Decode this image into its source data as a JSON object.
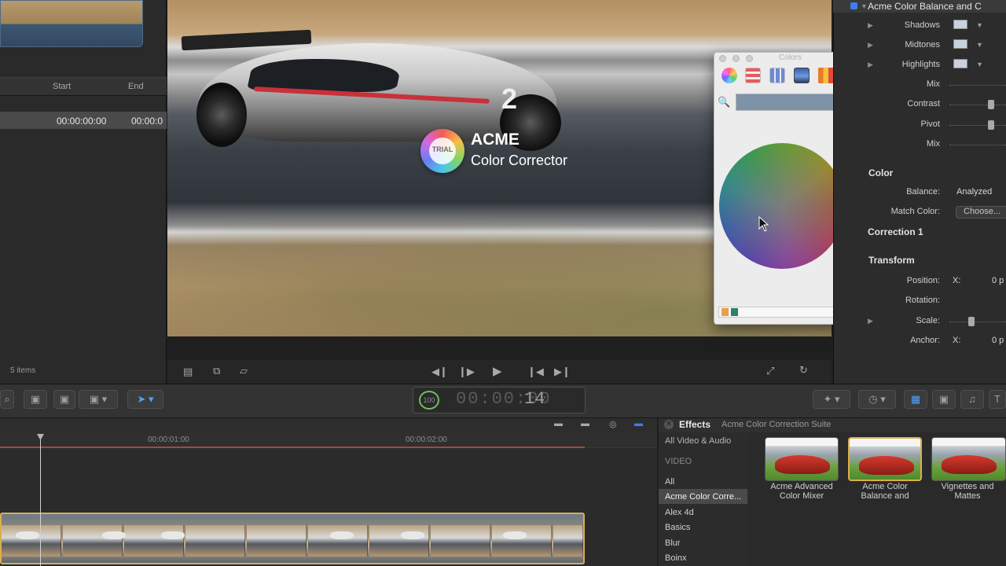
{
  "browser": {
    "col_start": "Start",
    "col_end": "End",
    "row_start": "00:00:00:00",
    "row_end": "00:00:0",
    "items_count": "5 items"
  },
  "viewer": {
    "car_number": "2",
    "trial_badge": "TRIAL",
    "brand_title": "ACME",
    "brand_subtitle": "Color Corrector"
  },
  "colors_window": {
    "title": "Colors",
    "search_icon": "search-icon",
    "selected_color": "#7f93a8"
  },
  "inspector": {
    "title": "Acme Color Balance and C",
    "rows": {
      "shadows": "Shadows",
      "midtones": "Midtones",
      "highlights": "Highlights",
      "mix1": "Mix",
      "contrast": "Contrast",
      "pivot": "Pivot",
      "mix2": "Mix"
    },
    "color_section": "Color",
    "balance_label": "Balance:",
    "balance_value": "Analyzed",
    "match_color_label": "Match Color:",
    "match_color_button": "Choose...",
    "correction_section": "Correction 1",
    "transform_section": "Transform",
    "position_label": "Position:",
    "position_axis": "X:",
    "position_value": "0 p",
    "rotation_label": "Rotation:",
    "scale_label": "Scale:",
    "anchor_label": "Anchor:",
    "anchor_axis": "X:",
    "anchor_value": "0 p"
  },
  "timecode": {
    "gauge": "100",
    "digits": "00:00:00",
    "frame": "14"
  },
  "timeline": {
    "ruler_1": "00:00:01:00",
    "ruler_2": "00:00:02:00"
  },
  "effects": {
    "title": "Effects",
    "subtitle": "Acme Color Correction Suite",
    "all_video_audio": "All Video & Audio",
    "video_heading": "VIDEO",
    "categories": [
      "All",
      "Acme Color Corre...",
      "Alex 4d",
      "Basics",
      "Blur",
      "Boinx"
    ],
    "items": [
      {
        "line1": "Acme Advanced",
        "line2": "Color Mixer"
      },
      {
        "line1": "Acme Color",
        "line2": "Balance and"
      },
      {
        "line1": "Vignettes and",
        "line2": "Mattes"
      }
    ]
  },
  "colors": {
    "accent": "#3b7ef0",
    "clip_border": "#d9b04a",
    "range_bar": "#a04b3b"
  }
}
